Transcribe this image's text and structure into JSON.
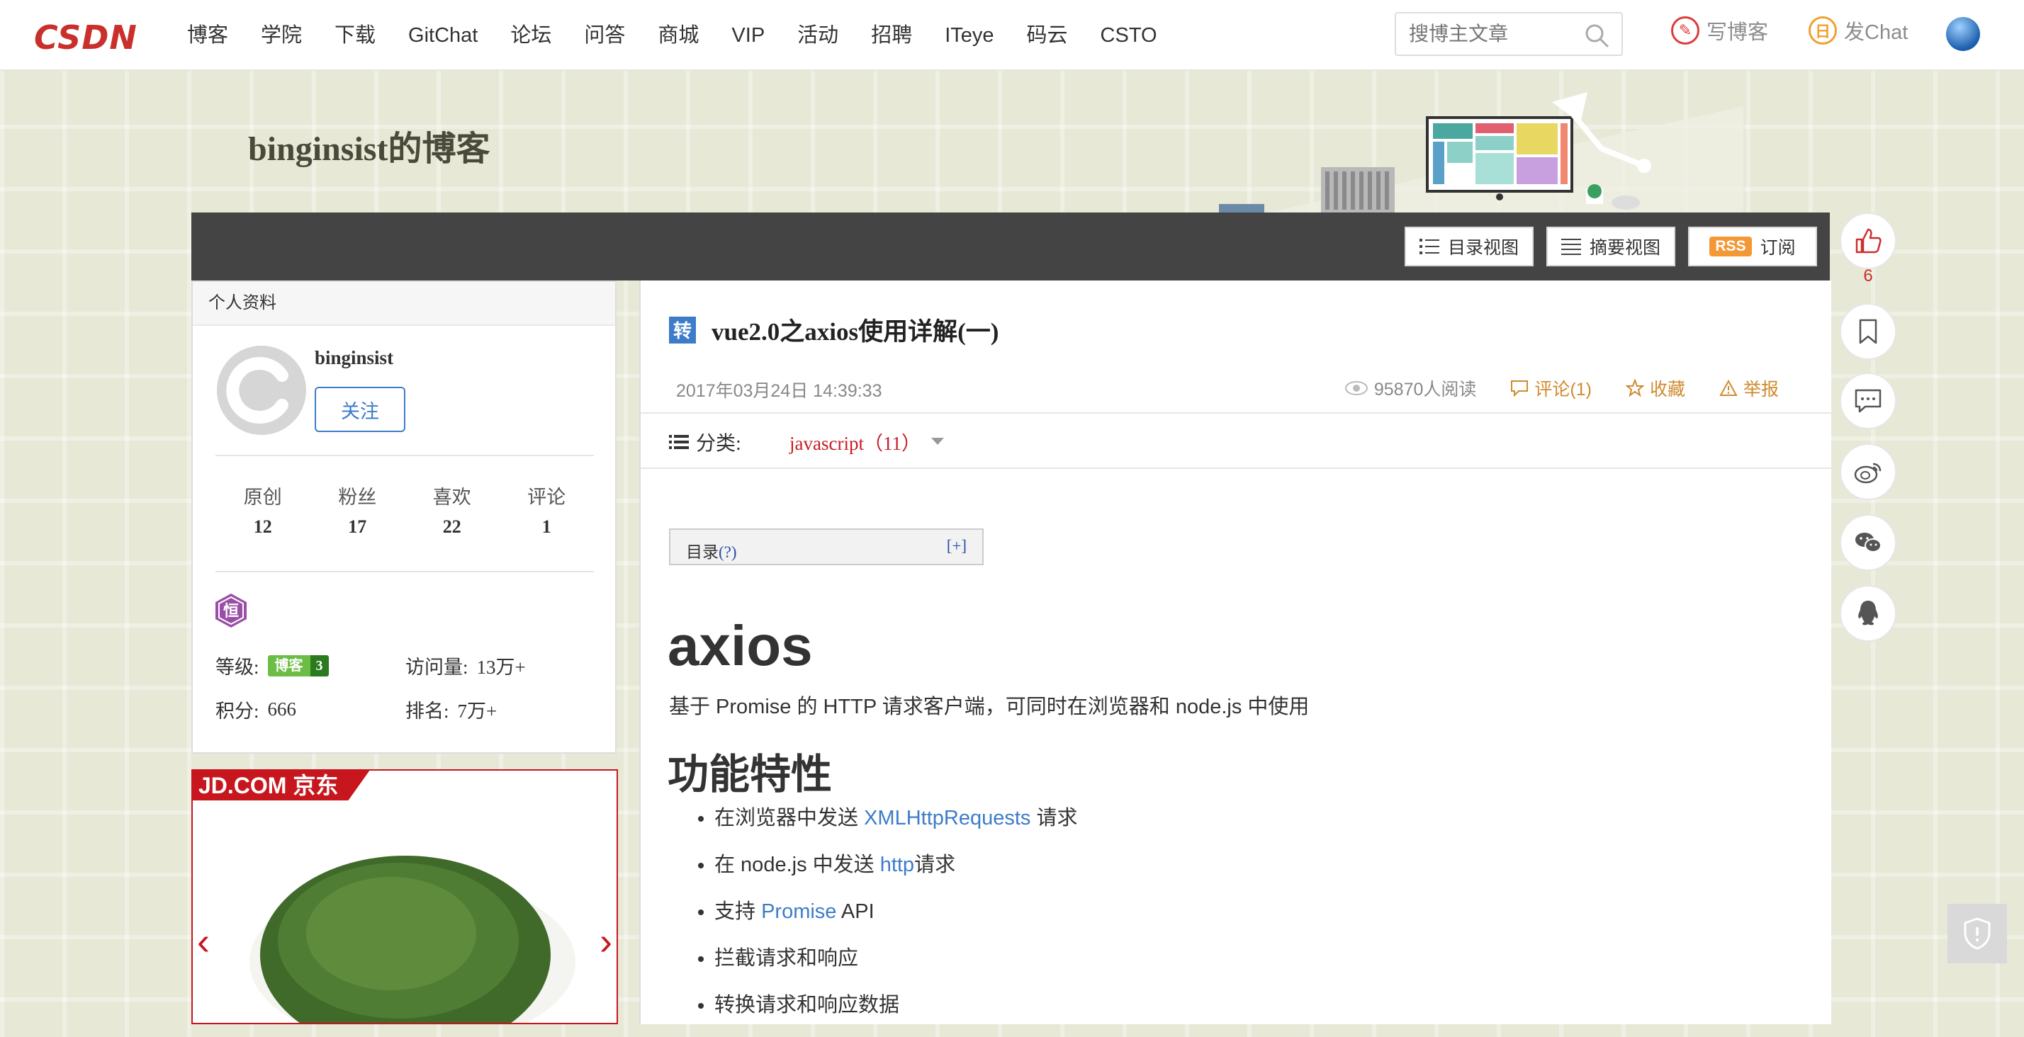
{
  "topnav": {
    "logo": "CSDN",
    "links": [
      "博客",
      "学院",
      "下载",
      "GitChat",
      "论坛",
      "问答",
      "商城",
      "VIP",
      "活动",
      "招聘",
      "ITeye",
      "码云",
      "CSTO"
    ],
    "search_placeholder": "搜博主文章",
    "write_blog": "写博客",
    "post_chat": "发Chat"
  },
  "blog": {
    "title": "binginsist的博客"
  },
  "toolbar": {
    "catalog_view": "目录视图",
    "summary_view": "摘要视图",
    "rss_tag": "RSS",
    "subscribe": "订阅"
  },
  "sidebar": {
    "heading": "个人资料",
    "username": "binginsist",
    "follow": "关注",
    "stats": [
      {
        "label": "原创",
        "value": "12"
      },
      {
        "label": "粉丝",
        "value": "17"
      },
      {
        "label": "喜欢",
        "value": "22"
      },
      {
        "label": "评论",
        "value": "1"
      }
    ],
    "medal": "恒",
    "level_label": "等级:",
    "level_badge_text": "博客",
    "level_badge_num": "3",
    "visits_label": "访问量:",
    "visits_value": "13万+",
    "points_label": "积分:",
    "points_value": "666",
    "rank_label": "排名:",
    "rank_value": "7万+"
  },
  "ad": {
    "brand": "JD.COM 京东"
  },
  "article": {
    "tag": "转",
    "title": "vue2.0之axios使用详解(一)",
    "date": "2017年03月24日 14:39:33",
    "reads": "95870人阅读",
    "comments": "评论(1)",
    "favorite": "收藏",
    "report": "举报",
    "category_label": "分类:",
    "category_value": "javascript（11）",
    "toc_label": "目录",
    "toc_help": "(?)",
    "toc_expand": "[+]",
    "h1": "axios",
    "intro": "基于 Promise 的 HTTP 请求客户端，可同时在浏览器和 node.js 中使用",
    "h2": "功能特性",
    "features": [
      {
        "pre": "在浏览器中发送 ",
        "link": "XMLHttpRequests",
        "post": " 请求"
      },
      {
        "pre": "在 node.js 中发送 ",
        "link": "http",
        "post": "请求"
      },
      {
        "pre": "支持 ",
        "link": "Promise",
        "post": " API"
      },
      {
        "pre": "拦截请求和响应",
        "link": "",
        "post": ""
      },
      {
        "pre": "转换请求和响应数据",
        "link": "",
        "post": ""
      }
    ]
  },
  "float": {
    "like_count": "6"
  },
  "colors": {
    "brand_red": "#c9302c",
    "link_blue": "#3d7cc9",
    "meta_orange": "#d08a2e",
    "bar_dark": "#444444",
    "page_bg": "#e7e8d6"
  }
}
